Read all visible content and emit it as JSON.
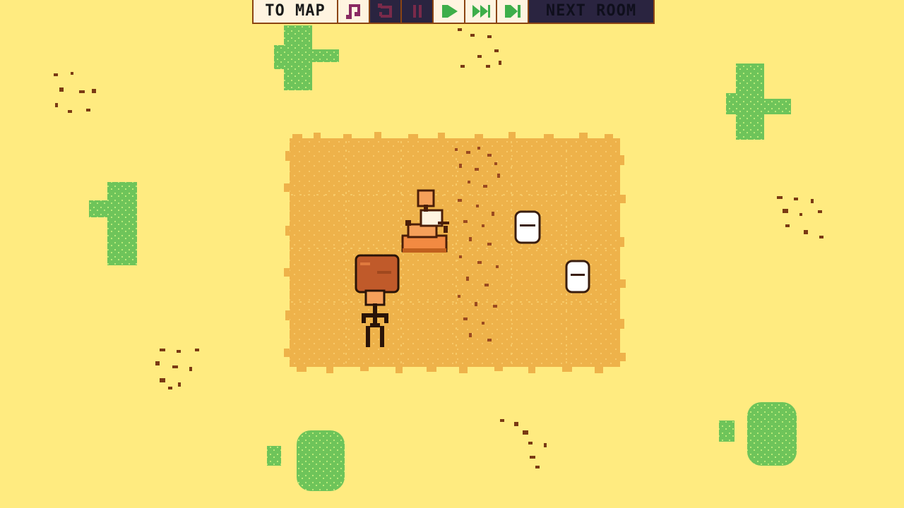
{
  "toolbar": {
    "to_map_label": "TO MAP",
    "next_room_label": "NEXT ROOM",
    "buttons": [
      {
        "name": "music-toggle-button",
        "icon": "music-note-icon",
        "enabled": true
      },
      {
        "name": "undo-button",
        "icon": "undo-icon",
        "enabled": false
      },
      {
        "name": "pause-button",
        "icon": "pause-icon",
        "enabled": false
      },
      {
        "name": "play-button",
        "icon": "play-icon",
        "enabled": true
      },
      {
        "name": "fast-forward-button",
        "icon": "fast-forward-icon",
        "enabled": true
      },
      {
        "name": "skip-button",
        "icon": "skip-icon",
        "enabled": true
      }
    ]
  },
  "colors": {
    "sand": "#ffeb80",
    "field": "#eeb24a",
    "cactus": "#6ec45a",
    "cactus_dots": "#c6f07a",
    "dirt": "#7a3a14",
    "outline": "#8b4513",
    "button_light": "#fff4e0",
    "button_dark": "#2a2440",
    "icon_active": "#3dae4a",
    "icon_music": "#8a2a62",
    "icon_disabled": "#7a2a4a"
  },
  "scene": {
    "farmer": {
      "carrying": "hay-bale"
    },
    "rider": {
      "mount": "cow"
    },
    "buckets": 2
  }
}
